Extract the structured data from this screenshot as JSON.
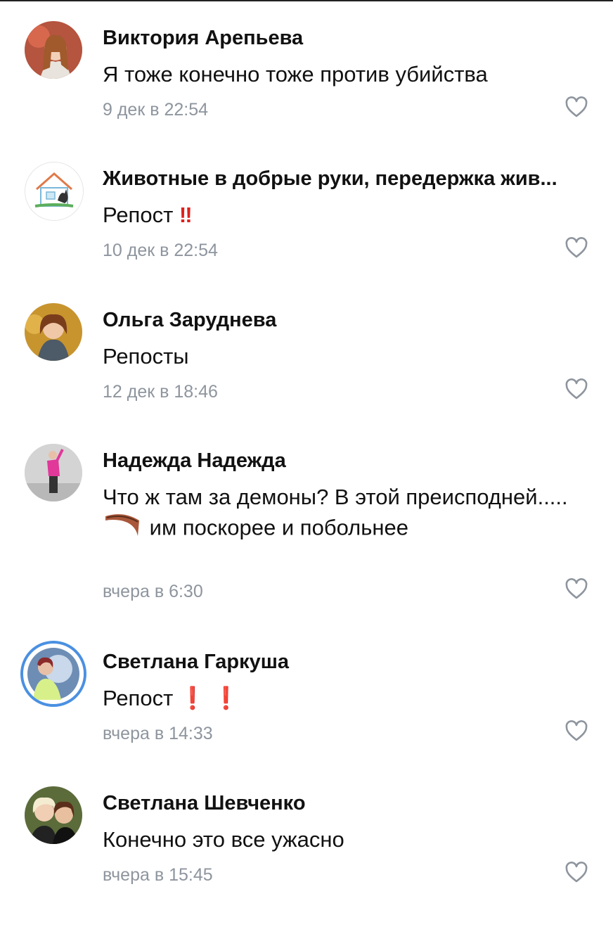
{
  "comments": [
    {
      "author": "Виктория Арепьева",
      "text": "Я тоже конечно тоже против убийства",
      "time": "9 дек в 22:54",
      "avatar_icon": "avatar-photo"
    },
    {
      "author": "Животные в добрые руки, передержка жив...",
      "text": "Репост",
      "emoji": "‼",
      "time": "10 дек в 22:54",
      "avatar_icon": "house-dog-logo"
    },
    {
      "author": "Ольга Заруднева",
      "text": "Репосты",
      "time": "12 дек в 18:46",
      "avatar_icon": "avatar-photo"
    },
    {
      "author": "Надежда Надежда",
      "text_part1": "Что ж там за демоны? В этой преисподней.....",
      "text_part2": "им поскорее и побольнее",
      "emoji": "boomerang",
      "time": "вчера в 6:30",
      "avatar_icon": "avatar-photo"
    },
    {
      "author": "Светлана Гаркуша",
      "text": "Репост",
      "emoji1": "❗",
      "emoji2": "❗",
      "time": "вчера в 14:33",
      "avatar_icon": "avatar-photo-with-story-ring"
    },
    {
      "author": "Светлана Шевченко",
      "text": "Конечно это все ужасно",
      "time": "вчера в 15:45",
      "avatar_icon": "avatar-photo"
    }
  ],
  "like_icon": "heart-outline-icon",
  "colors": {
    "time": "#8e959e",
    "exclamation": "#e0201c",
    "story_ring": "#4a90e2"
  }
}
